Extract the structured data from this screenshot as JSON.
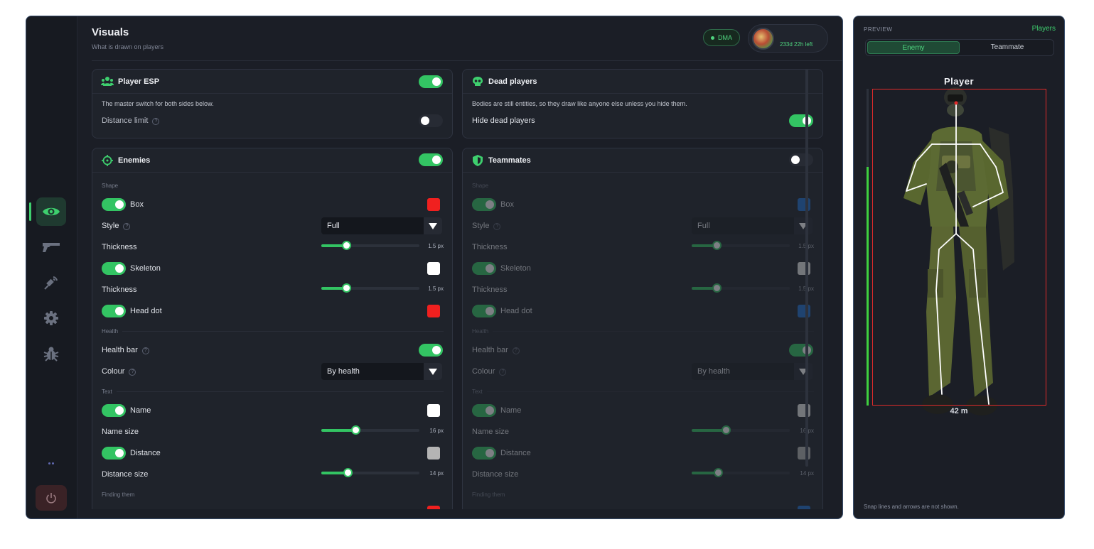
{
  "header": {
    "title": "Visuals",
    "subtitle": "What is drawn on players",
    "badge": "DMA",
    "time_left": "233d 22h left"
  },
  "sidebar": {
    "items": [
      {
        "name": "visuals",
        "icon": "eye-icon",
        "active": true
      },
      {
        "name": "weapons",
        "icon": "gun-icon",
        "active": false
      },
      {
        "name": "radar",
        "icon": "satellite-icon",
        "active": false
      },
      {
        "name": "settings",
        "icon": "gear-icon",
        "active": false
      },
      {
        "name": "debug",
        "icon": "bug-icon",
        "active": false
      }
    ],
    "power_icon": "power-icon"
  },
  "player_esp": {
    "title": "Player ESP",
    "enabled": true,
    "description": "The master switch for both sides below.",
    "distance_limit_label": "Distance limit",
    "distance_limit_on": false
  },
  "dead_players": {
    "title": "Dead players",
    "description": "Bodies are still entities, so they draw like anyone else unless you hide them.",
    "hide_label": "Hide dead players",
    "hide_on": true
  },
  "enemies": {
    "title": "Enemies",
    "enabled": true,
    "shape_label": "Shape",
    "box_label": "Box",
    "box_color": "#f0201f",
    "style_label": "Style",
    "style_value": "Full",
    "thickness_label": "Thickness",
    "box_thickness": "1.5 px",
    "box_thickness_frac": 0.25,
    "skeleton_label": "Skeleton",
    "skeleton_color": "#ffffff",
    "skeleton_thickness": "1.5 px",
    "skeleton_thickness_frac": 0.25,
    "head_dot_label": "Head dot",
    "head_dot_color": "#f0201f",
    "health_label": "Health",
    "health_bar_label": "Health bar",
    "colour_label": "Colour",
    "colour_value": "By health",
    "text_label": "Text",
    "name_label": "Name",
    "name_color": "#ffffff",
    "name_size_label": "Name size",
    "name_size": "16 px",
    "name_size_frac": 0.35,
    "distance_label": "Distance",
    "distance_color": "#b4b4b4",
    "distance_size_label": "Distance size",
    "distance_size": "14 px",
    "distance_size_frac": 0.27,
    "finding_label": "Finding them"
  },
  "teammates": {
    "title": "Teammates",
    "enabled": false,
    "shape_label": "Shape",
    "box_label": "Box",
    "box_color": "#1f6fd0",
    "style_label": "Style",
    "style_value": "Full",
    "thickness_label": "Thickness",
    "box_thickness": "1.5 px",
    "box_thickness_frac": 0.25,
    "skeleton_label": "Skeleton",
    "skeleton_color": "#e8e8e8",
    "skeleton_thickness": "1.5 px",
    "skeleton_thickness_frac": 0.25,
    "head_dot_label": "Head dot",
    "head_dot_color": "#1f6fd0",
    "health_label": "Health",
    "health_bar_label": "Health bar",
    "colour_label": "Colour",
    "colour_value": "By health",
    "text_label": "Text",
    "name_label": "Name",
    "name_color": "#e8e8e8",
    "name_size_label": "Name size",
    "name_size": "16 px",
    "name_size_frac": 0.35,
    "distance_label": "Distance",
    "distance_color": "#b4b4b4",
    "distance_size_label": "Distance size",
    "distance_size": "14 px",
    "distance_size_frac": 0.27,
    "finding_label": "Finding them"
  },
  "preview": {
    "label": "PREVIEW",
    "players": "Players",
    "tabs": [
      "Enemy",
      "Teammate"
    ],
    "player_name": "Player",
    "distance": "42 m",
    "health_frac": 0.75,
    "note": "Snap lines and arrows are not shown."
  },
  "colors": {
    "accent": "#33c463",
    "box_red": "#e02a2a"
  }
}
